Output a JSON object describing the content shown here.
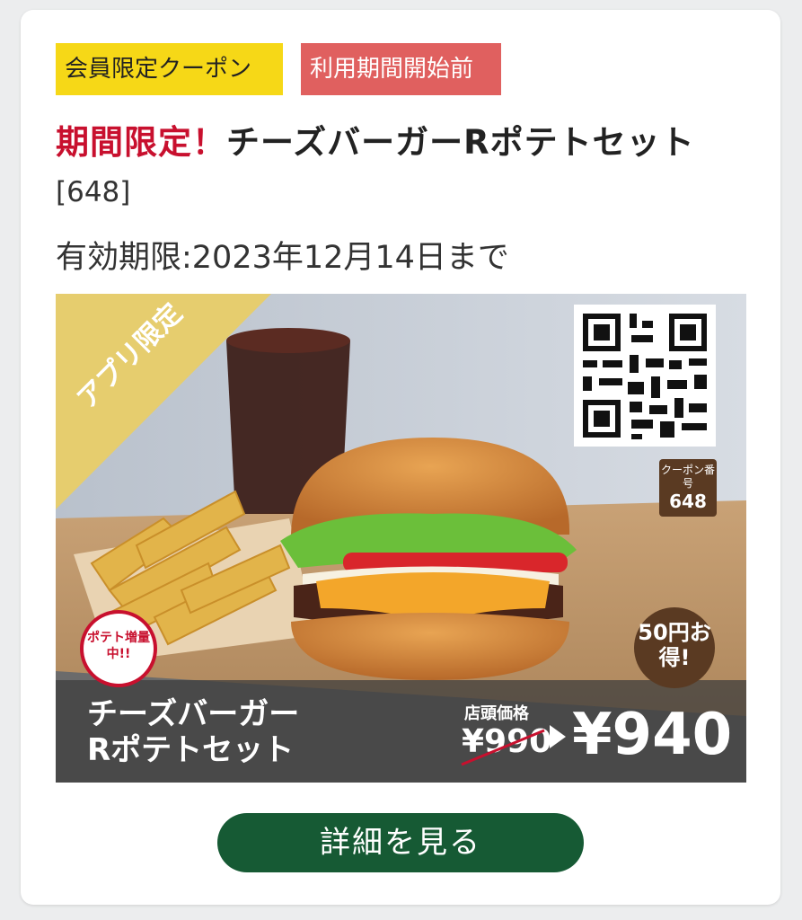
{
  "card": {
    "badges": {
      "member": "会員限定クーポン",
      "status": "利用期間開始前"
    },
    "title_accent": "期間限定！",
    "title_main": "チーズバーガーRポテトセット",
    "code": "[648]",
    "expiry": "有効期限:2023年12月14日まで",
    "detail_button": "詳細を見る"
  },
  "banner": {
    "ribbon": "アプリ限定",
    "coupon_label": "クーポン番号",
    "coupon_number": "648",
    "potato_badge": "ポテト増量中!!",
    "savings": "50円お得!",
    "product_name_line1": "チーズバーガー",
    "product_name_line2": "Rポテトセット",
    "store_price_label": "店頭価格",
    "old_price": "¥990",
    "new_price": "¥940"
  },
  "colors": {
    "accent_red": "#c8102e",
    "badge_yellow": "#f6d817",
    "badge_pink": "#e0605f",
    "button_green": "#165a34",
    "brown": "#5a3a22"
  }
}
